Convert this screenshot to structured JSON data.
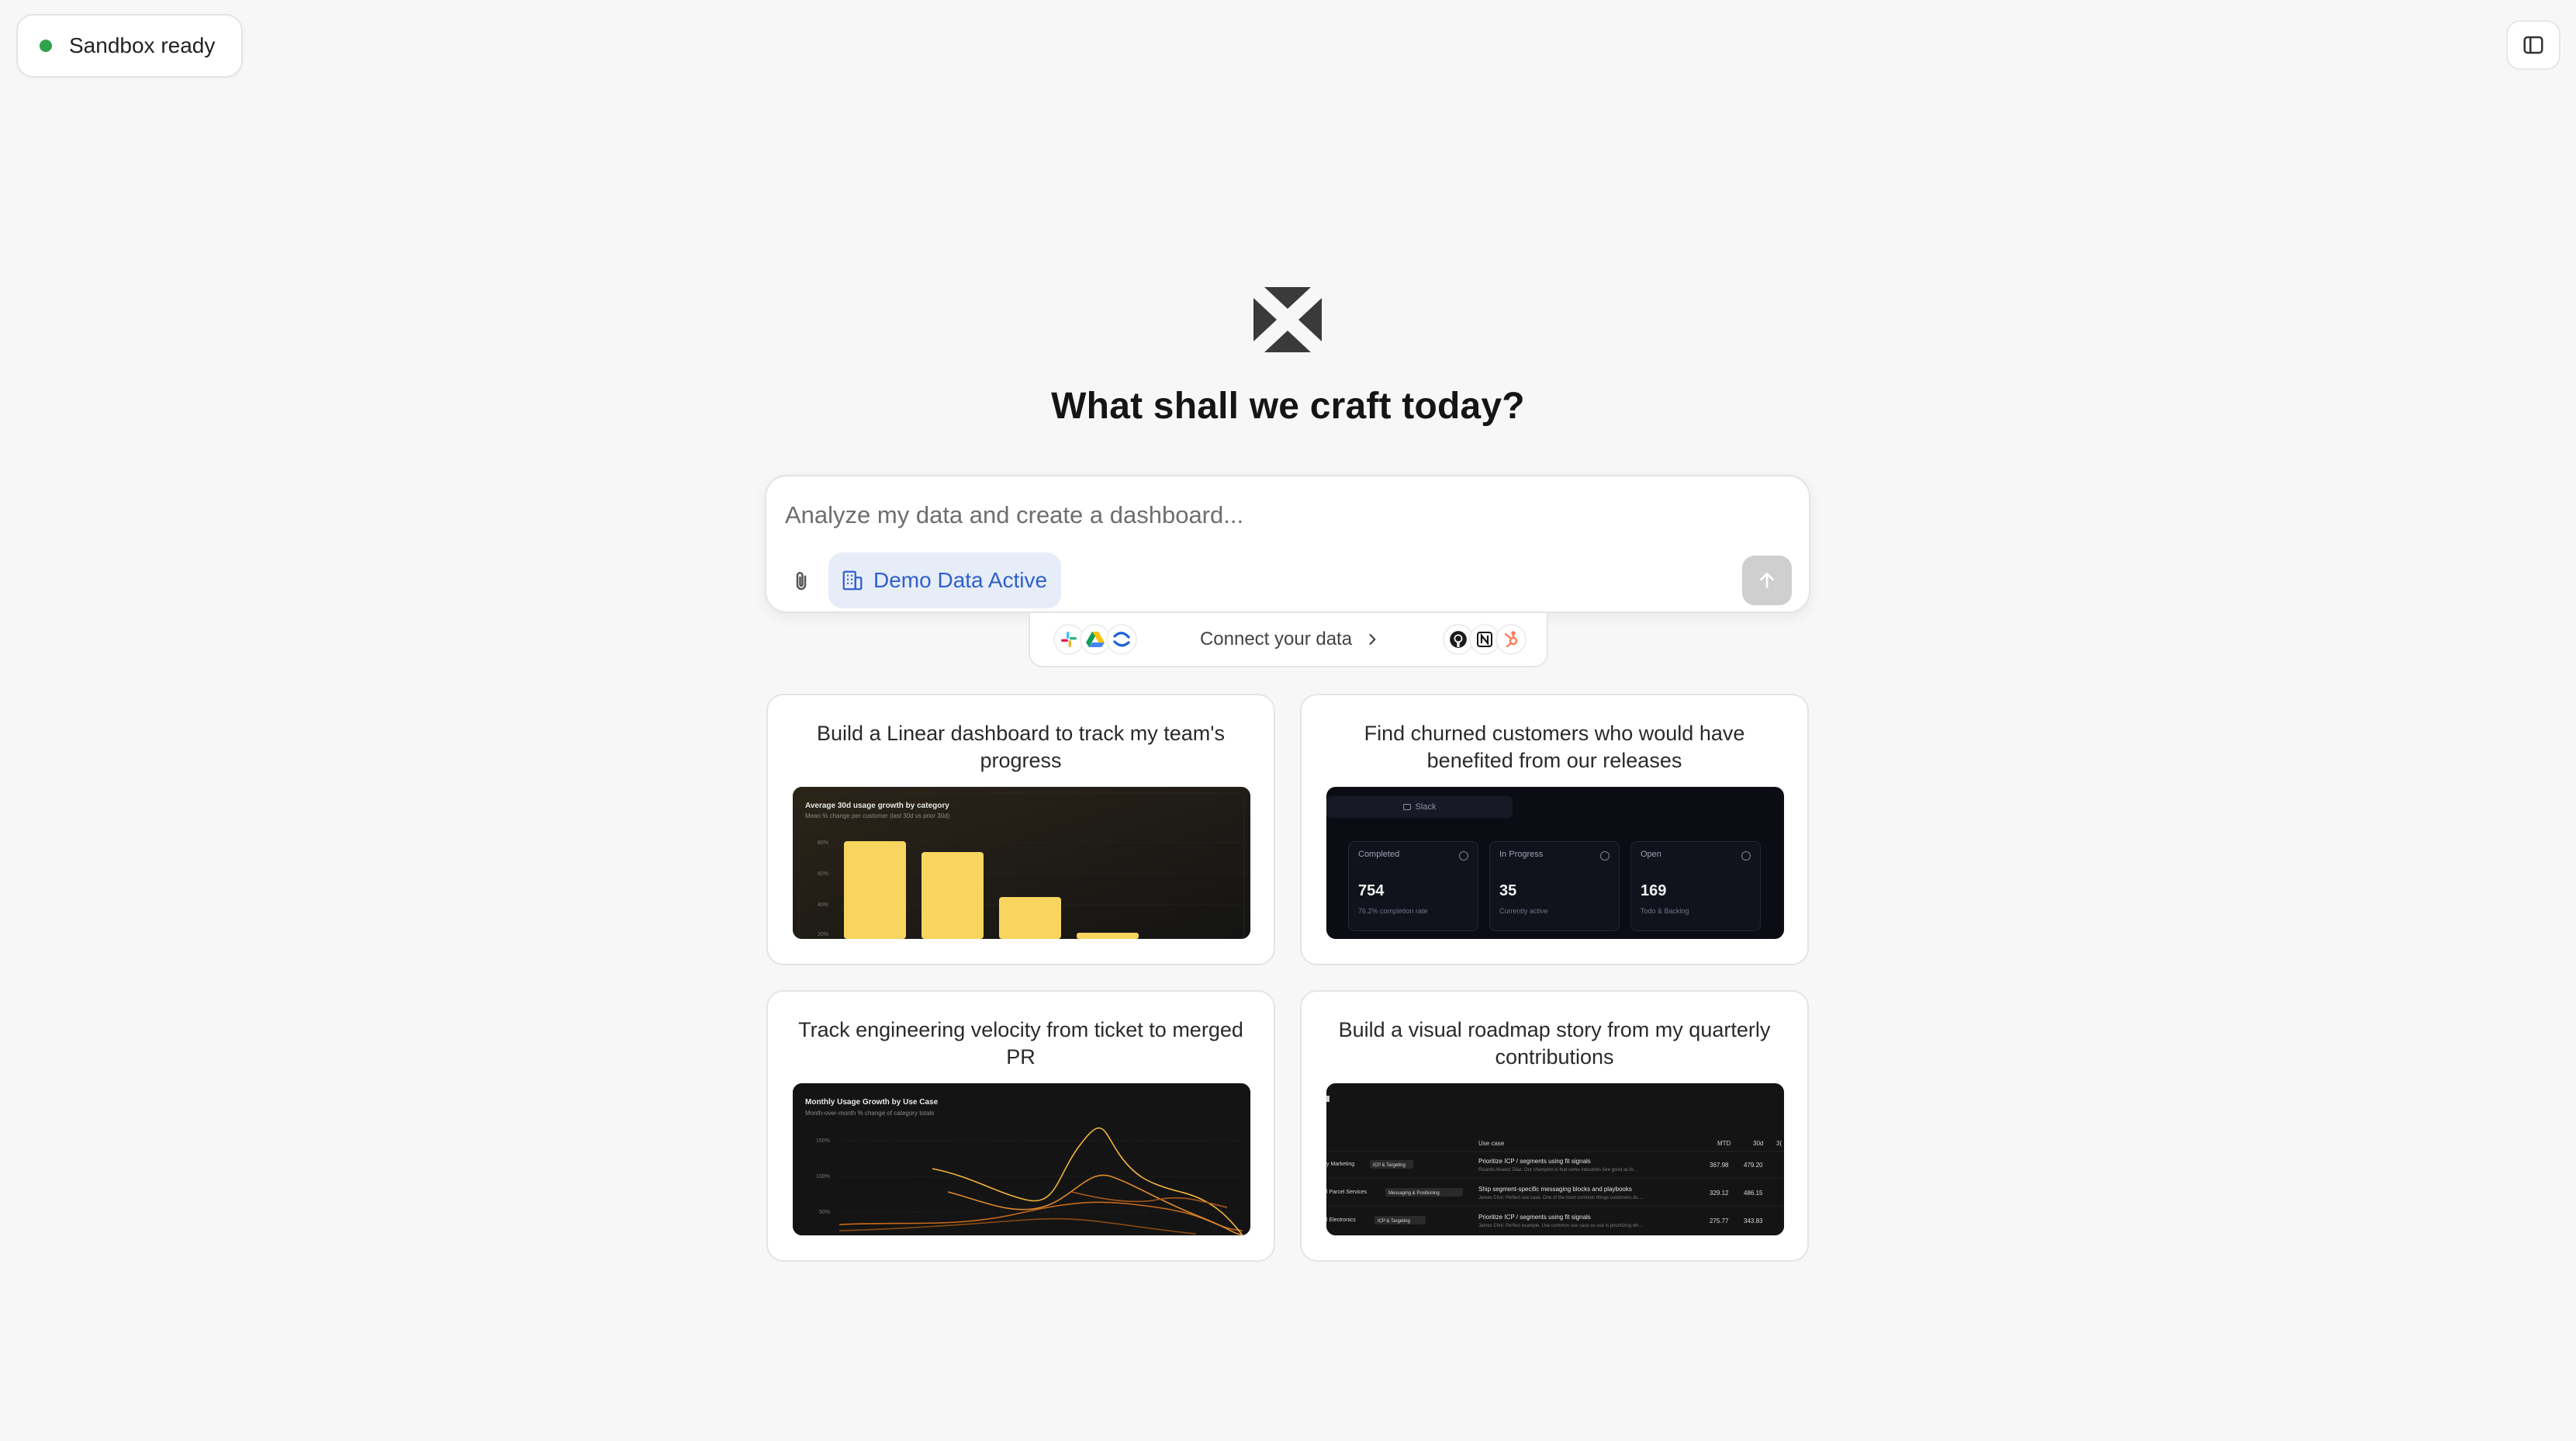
{
  "status": {
    "label": "Sandbox ready",
    "color": "#2fa24b"
  },
  "header": {
    "sidebar_toggle_icon": "sidebar-panel-icon"
  },
  "hero": {
    "title": "What shall we craft today?"
  },
  "prompt": {
    "placeholder": "Analyze my data and create a dashboard...",
    "demo_chip_label": "Demo Data Active",
    "accent_color": "#2f5fcc"
  },
  "connect": {
    "label": "Connect your data",
    "left_icons": [
      "slack-icon",
      "google-drive-icon",
      "confluence-icon"
    ],
    "right_icons": [
      "github-icon",
      "notion-icon",
      "hubspot-icon"
    ]
  },
  "cards": [
    {
      "title": "Build a Linear dashboard to track my team's progress",
      "preview": {
        "title": "Average 30d usage growth by category",
        "subtitle": "Mean % change per customer (last 30d vs prior 30d)",
        "y_ticks": [
          "80%",
          "60%",
          "40%",
          "20%"
        ]
      }
    },
    {
      "title": "Find churned customers who would have benefited from our releases",
      "preview": {
        "tab": "Slack",
        "tiles": [
          {
            "label": "Completed",
            "value": "754",
            "sub": "76.2% completion rate"
          },
          {
            "label": "In Progress",
            "value": "35",
            "sub": "Currently active"
          },
          {
            "label": "Open",
            "value": "169",
            "sub": "Todo & Backlog"
          }
        ]
      }
    },
    {
      "title": "Track engineering velocity from ticket to merged PR",
      "preview": {
        "title": "Monthly Usage Growth by Use Case",
        "subtitle": "Month-over-month % change of category totals",
        "y_ticks": [
          "150%",
          "100%",
          "50%"
        ]
      }
    },
    {
      "title": "Build a visual roadmap story from my quarterly contributions",
      "preview": {
        "headers": [
          "Use case",
          "MTD",
          "30d",
          "3("
        ],
        "rows": [
          {
            "segment": "y Marketing",
            "tag": "ICP & Targeting",
            "use_case": "Prioritize ICP / segments using fit signals",
            "note": "Ricardo Alvarez Diaz: Our champion is that some industries fare good as fo...",
            "mtd": "367.98",
            "d30": "479.20"
          },
          {
            "segment": "l Parcel Services",
            "tag": "Messaging & Positioning",
            "use_case": "Ship segment-specific messaging blocks and playbooks",
            "note": "James Choi: Perfect use case. One of the most common things customers do ...",
            "mtd": "329.12",
            "d30": "486.15"
          },
          {
            "segment": "l Electronics",
            "tag": "ICP & Targeting",
            "use_case": "Prioritize ICP / segments using fit signals",
            "note": "James Choi: Perfect example. Use common use case so use is prioritizing wh...",
            "mtd": "275.77",
            "d30": "343.83"
          }
        ]
      }
    }
  ]
}
